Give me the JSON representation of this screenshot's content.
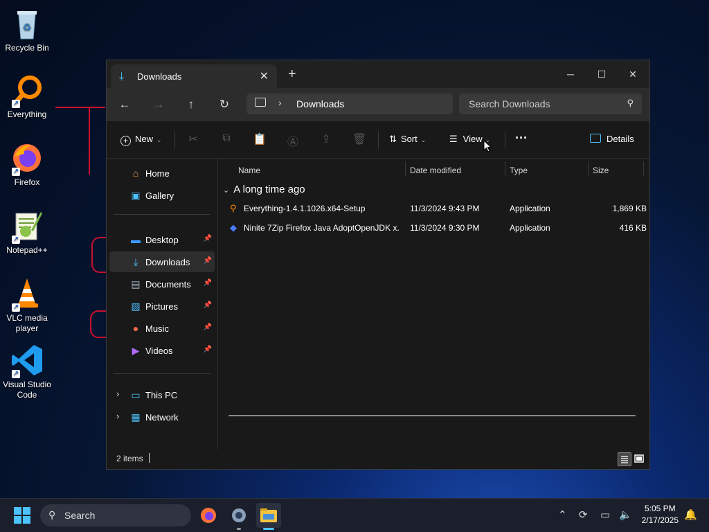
{
  "desktop": {
    "icons": [
      {
        "label": "Recycle Bin"
      },
      {
        "label": "Everything"
      },
      {
        "label": "Firefox"
      },
      {
        "label": "Notepad++"
      },
      {
        "label": "VLC media player"
      },
      {
        "label": "Visual Studio Code"
      }
    ]
  },
  "window": {
    "tab_title": "Downloads",
    "address": {
      "location": "Downloads"
    },
    "search_placeholder": "Search Downloads",
    "toolbar": {
      "new_label": "New",
      "sort_label": "Sort",
      "view_label": "View",
      "more_label": "···",
      "details_label": "Details"
    },
    "sidebar": {
      "home": "Home",
      "gallery": "Gallery",
      "quick": [
        {
          "label": "Desktop"
        },
        {
          "label": "Downloads"
        },
        {
          "label": "Documents"
        },
        {
          "label": "Pictures"
        },
        {
          "label": "Music"
        },
        {
          "label": "Videos"
        }
      ],
      "this_pc": "This PC",
      "network": "Network"
    },
    "columns": {
      "name": "Name",
      "date": "Date modified",
      "type": "Type",
      "size": "Size"
    },
    "group": "A long time ago",
    "files": [
      {
        "name": "Everything-1.4.1.1026.x64-Setup",
        "date": "11/3/2024 9:43 PM",
        "type": "Application",
        "size": "1,869 KB"
      },
      {
        "name": "Ninite 7Zip Firefox Java AdoptOpenJDK x...",
        "date": "11/3/2024 9:30 PM",
        "type": "Application",
        "size": "416 KB"
      }
    ],
    "status": "2 items"
  },
  "taskbar": {
    "search_label": "Search",
    "time": "5:05 PM",
    "date": "2/17/2025"
  },
  "colors": {
    "accent": "#4cc2ff",
    "window_bg": "#191919",
    "annotation_red": "#c8102e"
  }
}
